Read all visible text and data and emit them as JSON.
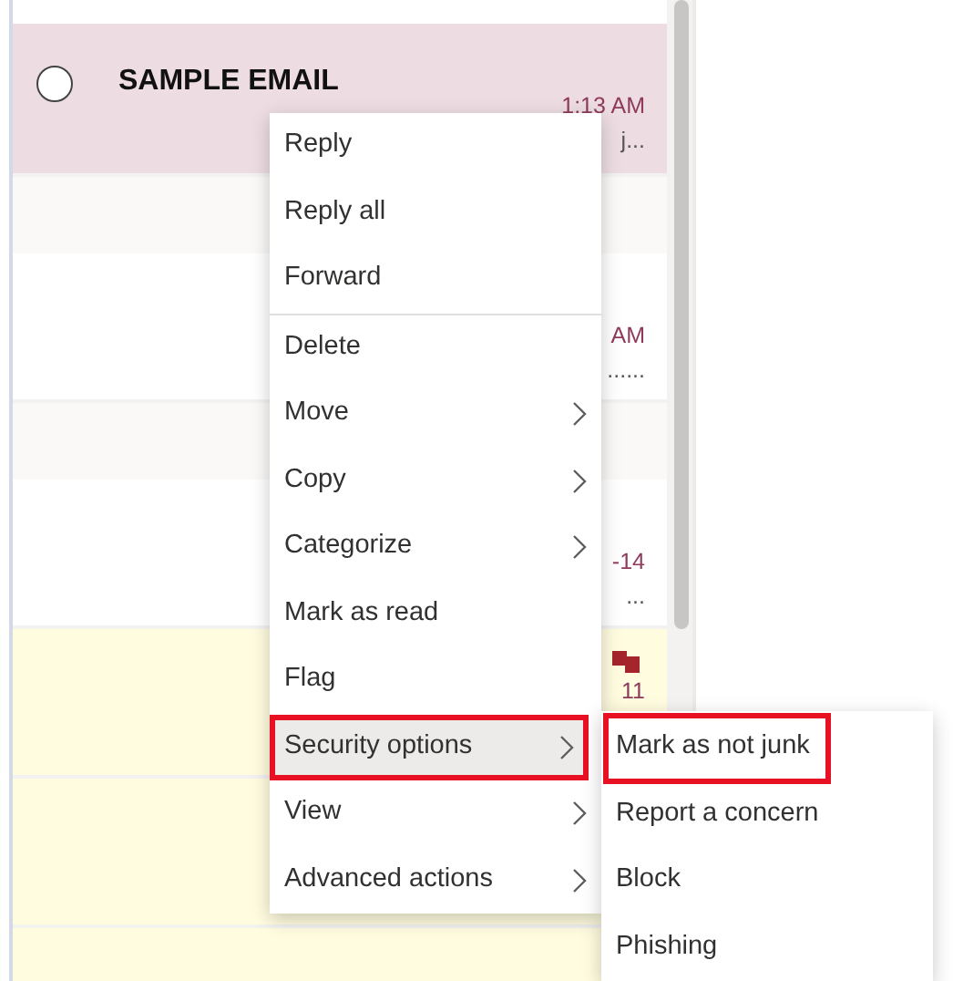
{
  "message_list": {
    "rows": [
      {
        "kind": "message",
        "selected": true,
        "highlighted": false,
        "category_marks": false,
        "sender": "SAMPLE EMAIL",
        "time": "1:13 AM",
        "preview": "j..."
      },
      {
        "kind": "header"
      },
      {
        "kind": "message",
        "selected": false,
        "highlighted": false,
        "category_marks": false,
        "time": "AM",
        "preview": "......"
      },
      {
        "kind": "header"
      },
      {
        "kind": "message",
        "selected": false,
        "highlighted": false,
        "category_marks": false,
        "time": "-14",
        "preview": "..."
      },
      {
        "kind": "message",
        "selected": false,
        "highlighted": true,
        "category_marks": true,
        "time": "11"
      },
      {
        "kind": "message",
        "selected": false,
        "highlighted": true,
        "category_marks": false
      },
      {
        "kind": "message",
        "selected": false,
        "highlighted": true,
        "category_marks": false
      }
    ]
  },
  "context_menu": {
    "groups": [
      {
        "items": [
          {
            "label": "Reply",
            "submenu": false,
            "selected": false,
            "annotated": false
          },
          {
            "label": "Reply all",
            "submenu": false,
            "selected": false,
            "annotated": false
          },
          {
            "label": "Forward",
            "submenu": false,
            "selected": false,
            "annotated": false
          }
        ]
      },
      {
        "items": [
          {
            "label": "Delete",
            "submenu": false,
            "selected": false,
            "annotated": false
          },
          {
            "label": "Move",
            "submenu": true,
            "selected": false,
            "annotated": false
          },
          {
            "label": "Copy",
            "submenu": true,
            "selected": false,
            "annotated": false
          },
          {
            "label": "Categorize",
            "submenu": true,
            "selected": false,
            "annotated": false
          },
          {
            "label": "Mark as read",
            "submenu": false,
            "selected": false,
            "annotated": false
          },
          {
            "label": "Flag",
            "submenu": false,
            "selected": false,
            "annotated": false
          },
          {
            "label": "Security options",
            "submenu": true,
            "selected": true,
            "annotated": true
          },
          {
            "label": "View",
            "submenu": true,
            "selected": false,
            "annotated": false
          },
          {
            "label": "Advanced actions",
            "submenu": true,
            "selected": false,
            "annotated": false
          }
        ]
      }
    ]
  },
  "submenu": {
    "items": [
      {
        "label": "Mark as not junk",
        "annotated": true
      },
      {
        "label": "Report a concern",
        "annotated": false
      },
      {
        "label": "Block",
        "annotated": false
      },
      {
        "label": "Phishing",
        "annotated": false
      }
    ]
  }
}
